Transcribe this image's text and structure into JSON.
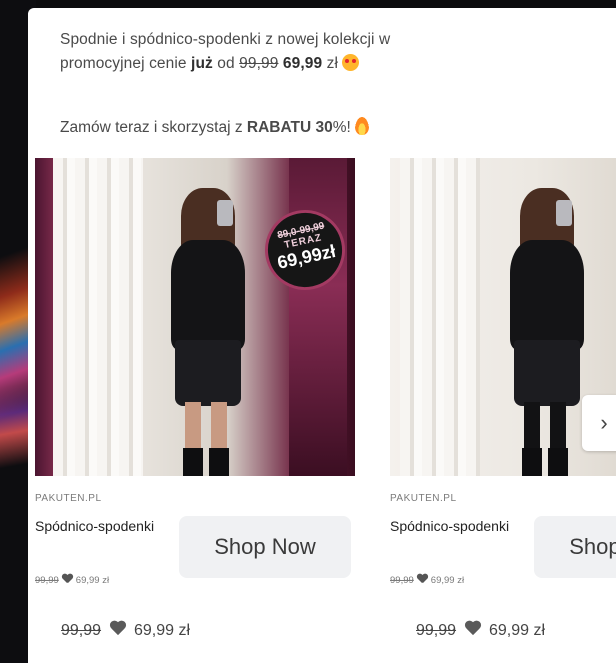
{
  "post": {
    "line1_a": "Spodnie i spódnico-spodenki z nowej kolekcji w",
    "line1_b": "promocyjnej cenie",
    "line1_bold": "już",
    "line1_c": "od",
    "line1_old": "99,99",
    "line1_new": "69,99",
    "line1_currency": "zł",
    "line1_emoji": "star-struck-emoji",
    "line2_a": "Zamów teraz i skorzystaj z",
    "line2_bold": "RABATU 30",
    "line2_b": "%!",
    "line2_emoji": "fire-emoji"
  },
  "cards": [
    {
      "badge_old": "89,0-99,99",
      "badge_label": "TERAZ",
      "badge_new": "69,99zł",
      "source": "PAKUTEN.PL",
      "title": "Spódnico-spodenki",
      "mini_old": "99,99",
      "mini_new": "69,99 zł",
      "button": "Shop Now",
      "footer_old": "99,99",
      "footer_new": "69,99 zł"
    },
    {
      "source": "PAKUTEN.PL",
      "title": "Spódnico-spodenki",
      "mini_old": "99,99",
      "mini_new": "69,99 zł",
      "button": "Shop Now",
      "footer_old": "99,99",
      "footer_new": "69,99 zł",
      "next_arrow": "›"
    }
  ],
  "colors": {
    "badge_border": "#a33a62",
    "button_bg": "#f0f1f3",
    "heart": "#555555"
  }
}
